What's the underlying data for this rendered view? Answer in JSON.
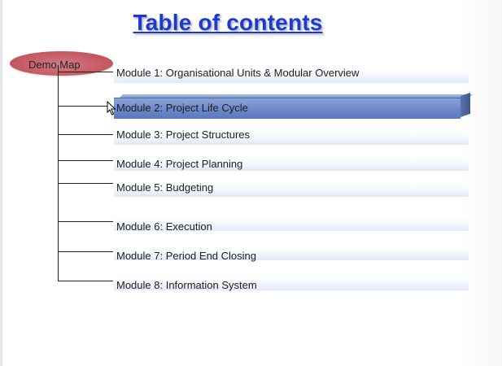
{
  "slide": {
    "title": "Table of contents",
    "root_label": "Demo Map"
  },
  "modules": [
    {
      "label": "Module 1: Organisational Units & Modular Overview",
      "active": false
    },
    {
      "label": "Module 2: Project Life Cycle",
      "active": true
    },
    {
      "label": "Module 3: Project Structures",
      "active": false
    },
    {
      "label": "Module 4: Project Planning",
      "active": false
    },
    {
      "label": "Module 5: Budgeting",
      "active": false
    },
    {
      "label": "Module 6: Execution",
      "active": false
    },
    {
      "label": "Module 7: Period End Closing",
      "active": false
    },
    {
      "label": "Module 8: Information System",
      "active": false
    }
  ],
  "colors": {
    "title": "#1a3ad6",
    "root_node": "#c9606a",
    "active_item": "#6b88c9"
  },
  "icons": {
    "cursor": "mouse-pointer-icon"
  }
}
